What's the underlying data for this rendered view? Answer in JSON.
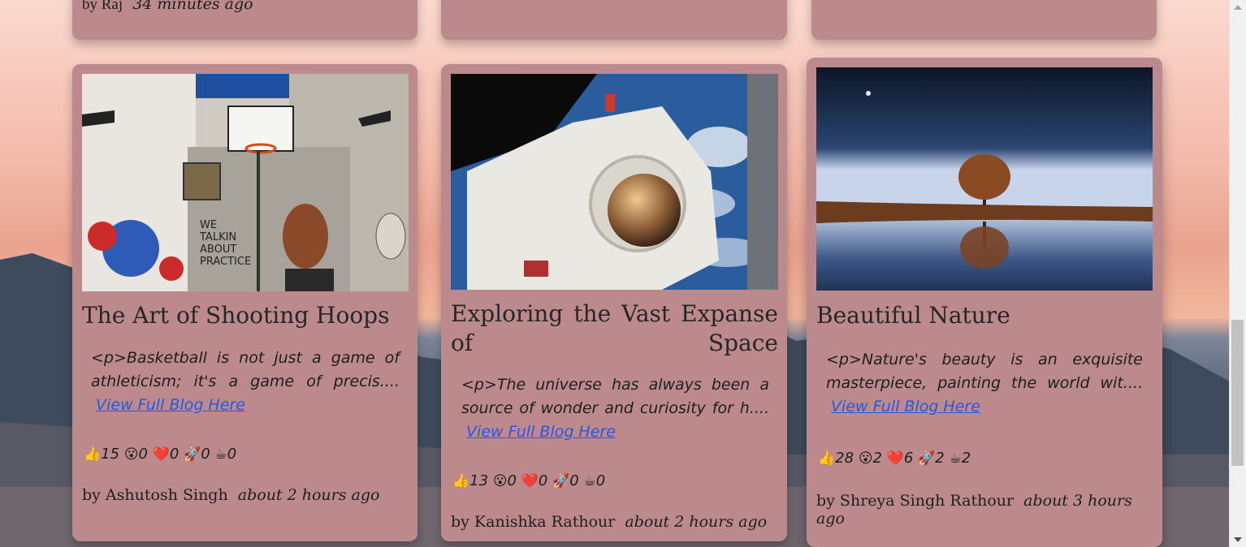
{
  "top_row": [
    {
      "author": "by Raj",
      "time": "34 minutes ago"
    },
    {
      "author": "",
      "time": ""
    },
    {
      "author": "",
      "time": ""
    }
  ],
  "cards": [
    {
      "title": "The Art of Shooting Hoops",
      "excerpt": "<p>Basketball is not just a game of athleticism; it's a game of precis....",
      "link": "View Full Blog Here",
      "reactions": {
        "like": "15",
        "wow": "0",
        "heart": "0",
        "rocket": "0",
        "coffee": "0"
      },
      "author": "by Ashutosh Singh",
      "time": "about 2 hours ago"
    },
    {
      "title": "Exploring the Vast Expanse of Space",
      "excerpt": "<p>The universe has always been a source of wonder and curiosity for h....",
      "link": "View Full Blog Here",
      "reactions": {
        "like": "13",
        "wow": "0",
        "heart": "0",
        "rocket": "0",
        "coffee": "0"
      },
      "author": "by Kanishka Rathour",
      "time": "about 2 hours ago"
    },
    {
      "title": "Beautiful Nature",
      "excerpt": "<p>Nature's beauty is an exquisite masterpiece, painting the world wit....",
      "link": "View Full Blog Here",
      "reactions": {
        "like": "28",
        "wow": "2",
        "heart": "6",
        "rocket": "2",
        "coffee": "2"
      },
      "author": "by Shreya Singh Rathour",
      "time": "about 3 hours ago"
    }
  ],
  "icons": {
    "like": "👍",
    "wow": "😮",
    "heart": "❤️",
    "rocket": "🚀",
    "coffee": "☕"
  }
}
